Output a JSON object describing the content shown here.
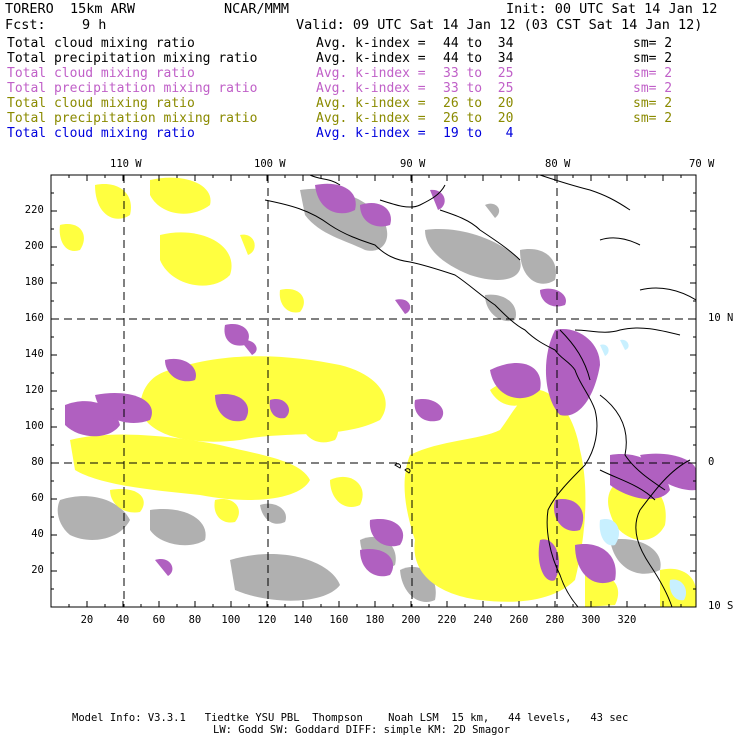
{
  "header": {
    "model": "TORERO  15km ARW",
    "org": "NCAR/MMM",
    "init": "Init: 00 UTC Sat 14 Jan 12",
    "fcst_label": "Fcst:",
    "fcst_value": "9 h",
    "valid": "Valid: 09 UTC Sat 14 Jan 12 (03 CST Sat 14 Jan 12)"
  },
  "legend": [
    {
      "field": "Total cloud mixing ratio",
      "kindex": "Avg. k-index =",
      "range": "44 to  34",
      "sm": "sm= 2",
      "color": "#000000"
    },
    {
      "field": "Total precipitation mixing ratio",
      "kindex": "Avg. k-index =",
      "range": "44 to  34",
      "sm": "sm= 2",
      "color": "#000000"
    },
    {
      "field": "Total cloud mixing ratio",
      "kindex": "Avg. k-index =",
      "range": "33 to  25",
      "sm": "sm= 2",
      "color": "#c060c8"
    },
    {
      "field": "Total precipitation mixing ratio",
      "kindex": "Avg. k-index =",
      "range": "33 to  25",
      "sm": "sm= 2",
      "color": "#c060c8"
    },
    {
      "field": "Total cloud mixing ratio",
      "kindex": "Avg. k-index =",
      "range": "26 to  20",
      "sm": "sm= 2",
      "color": "#8a8a00"
    },
    {
      "field": "Total precipitation mixing ratio",
      "kindex": "Avg. k-index =",
      "range": "26 to  20",
      "sm": "sm= 2",
      "color": "#8a8a00"
    },
    {
      "field": "Total cloud mixing ratio",
      "kindex": "Avg. k-index =",
      "range": "19 to   4",
      "sm": "",
      "color": "#0000dd"
    }
  ],
  "map": {
    "lon_labels": [
      "110 W",
      "100 W",
      "90 W",
      "80 W",
      "70 W"
    ],
    "lat_labels": [
      "10 N",
      "0",
      "10 S"
    ],
    "x_ticks": [
      "20",
      "40",
      "60",
      "80",
      "100",
      "120",
      "140",
      "160",
      "180",
      "200",
      "220",
      "240",
      "260",
      "280",
      "300",
      "320"
    ],
    "y_ticks": [
      "220",
      "200",
      "180",
      "160",
      "140",
      "120",
      "100",
      "80",
      "60",
      "40",
      "20"
    ],
    "colors": {
      "gray": "#a0a0a0",
      "purple": "#b060c0",
      "yellow": "#ffff30",
      "cyan": "#c8f0ff"
    }
  },
  "footer": {
    "line1": "Model Info: V3.3.1   Tiedtke YSU PBL  Thompson    Noah LSM  15 km,   44 levels,   43 sec",
    "line2": "LW: Godd SW: Goddard DIFF: simple KM: 2D Smagor"
  }
}
